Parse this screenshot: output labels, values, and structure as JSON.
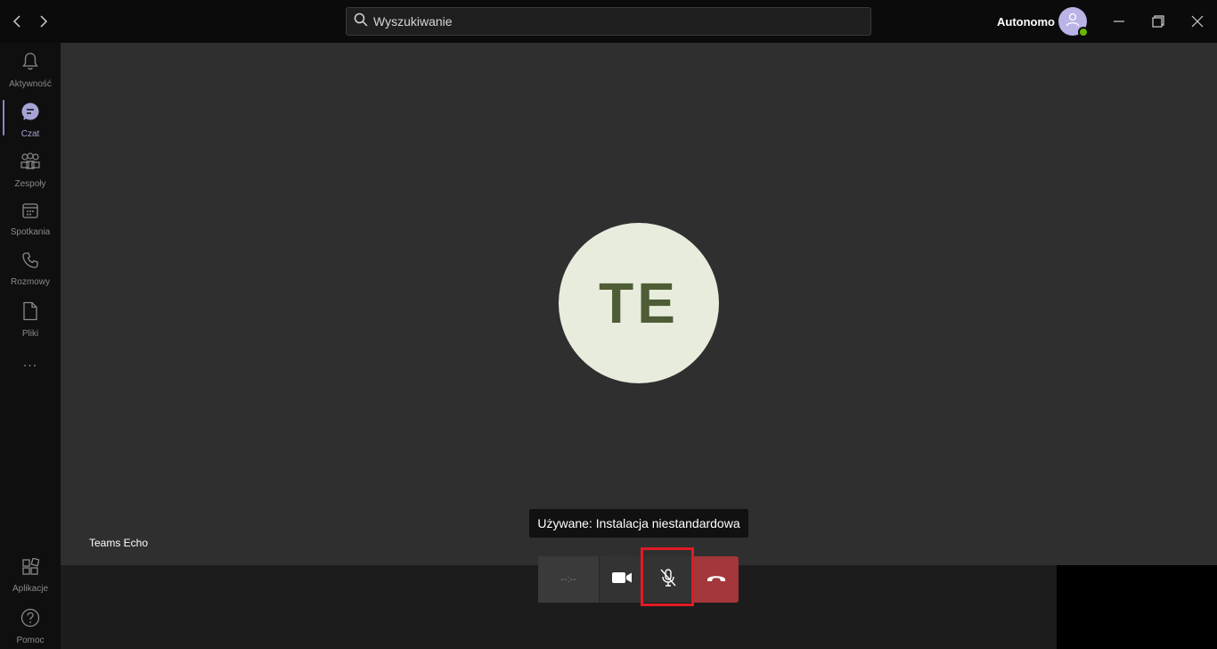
{
  "titlebar": {
    "search_placeholder": "Wyszukiwanie",
    "user_name": "Autonomo"
  },
  "rail": {
    "items": [
      {
        "label": "Aktywność",
        "icon": "bell-icon"
      },
      {
        "label": "Czat",
        "icon": "chat-icon",
        "active": true
      },
      {
        "label": "Zespoły",
        "icon": "teams-icon"
      },
      {
        "label": "Spotkania",
        "icon": "calendar-icon"
      },
      {
        "label": "Rozmowy",
        "icon": "phone-icon"
      },
      {
        "label": "Pliki",
        "icon": "file-icon"
      }
    ],
    "more": "...",
    "bottom_items": [
      {
        "label": "Aplikacje",
        "icon": "apps-icon"
      },
      {
        "label": "Pomoc",
        "icon": "help-icon"
      }
    ]
  },
  "call": {
    "initials": "TE",
    "participant_name": "Teams Echo",
    "tooltip": "Używane: Instalacja niestandardowa",
    "timer": "--:--"
  },
  "colors": {
    "accent": "#8a86c9",
    "hangup": "#a4373a",
    "avatar_bg": "#e7ecdd",
    "highlight": "#e01b24"
  }
}
